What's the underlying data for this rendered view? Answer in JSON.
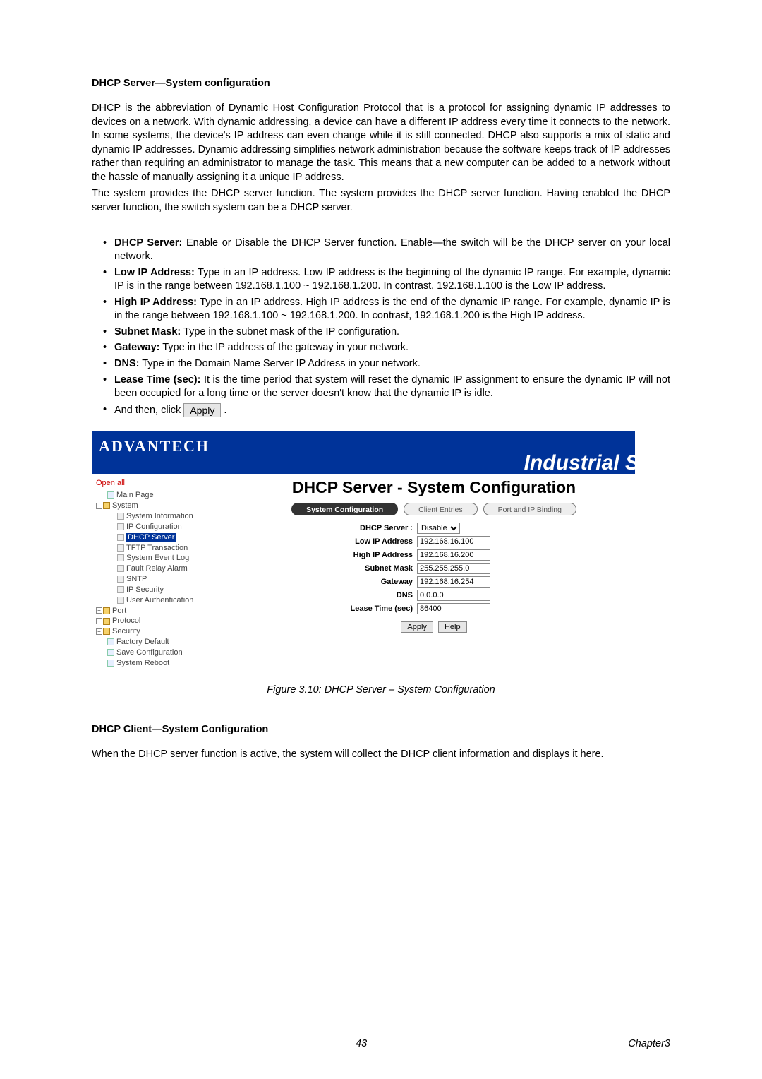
{
  "section1": {
    "title": "DHCP Server—System configuration",
    "para1": "DHCP is the abbreviation of Dynamic Host Configuration Protocol that is a protocol for assigning dynamic IP addresses to devices on a network. With dynamic addressing, a device can have a different IP address every time it connects to the network. In some systems, the device's IP address can even change while it is still connected. DHCP also supports a mix of static and dynamic IP addresses. Dynamic addressing simplifies network administration because the software keeps track of IP addresses rather than requiring an administrator to manage the task. This means that a new computer can be added to a network without the hassle of manually assigning it a unique IP address.",
    "para2": "The system provides the DHCP server function. The system provides the DHCP server function. Having enabled the DHCP server function, the switch system can be a DHCP server."
  },
  "bullets": [
    {
      "lead": "DHCP Server:",
      "rest": " Enable or Disable the DHCP Server function. Enable—the switch will be the DHCP server on your local network."
    },
    {
      "lead": "Low IP Address:",
      "rest": " Type in an IP address. Low IP address is the beginning of the dynamic IP range. For example, dynamic IP is in the range between 192.168.1.100 ~ 192.168.1.200. In contrast, 192.168.1.100 is the Low IP address."
    },
    {
      "lead": "High IP Address:",
      "rest": " Type in an IP address. High IP address is the end of the dynamic IP range. For example, dynamic IP is in the range between 192.168.1.100 ~ 192.168.1.200. In contrast, 192.168.1.200 is the High IP address."
    },
    {
      "lead": "Subnet Mask:",
      "rest": " Type in the subnet mask of the IP configuration."
    },
    {
      "lead": "Gateway:",
      "rest": " Type in the IP address of the gateway in your network."
    },
    {
      "lead": "DNS:",
      "rest": " Type in the Domain Name Server IP Address in your network."
    },
    {
      "lead": "Lease Time (sec):",
      "rest": " It is the time period that system will reset the dynamic IP assignment to ensure the dynamic IP will not been occupied for a long time or the server doesn't know that the dynamic IP is idle."
    }
  ],
  "andThen": {
    "pre": "And then, click ",
    "btn": "Apply",
    "post": " ."
  },
  "screenshot": {
    "brand": "ADVANTECH",
    "product": "Industrial S",
    "sidebar": {
      "open_all": "Open all",
      "main_page": "Main Page",
      "system": "System",
      "system_children": [
        "System Information",
        "IP Configuration",
        "DHCP Server",
        "TFTP Transaction",
        "System Event Log",
        "Fault Relay Alarm",
        "SNTP",
        "IP Security",
        "User Authentication"
      ],
      "port": "Port",
      "protocol": "Protocol",
      "security": "Security",
      "factory_default": "Factory Default",
      "save_config": "Save Configuration",
      "system_reboot": "System Reboot"
    },
    "panel": {
      "title": "DHCP Server - System Configuration",
      "tabs": [
        "System Configuration",
        "Client Entries",
        "Port and IP Binding"
      ],
      "active_tab": 0,
      "dhcp_label": "DHCP Server :",
      "dhcp_value": "Disable",
      "fields": [
        {
          "label": "Low IP Address",
          "value": "192.168.16.100"
        },
        {
          "label": "High IP Address",
          "value": "192.168.16.200"
        },
        {
          "label": "Subnet Mask",
          "value": "255.255.255.0"
        },
        {
          "label": "Gateway",
          "value": "192.168.16.254"
        },
        {
          "label": "DNS",
          "value": "0.0.0.0"
        },
        {
          "label": "Lease Time (sec)",
          "value": "86400"
        }
      ],
      "apply": "Apply",
      "help": "Help"
    }
  },
  "figure_caption": "Figure 3.10: DHCP Server – System Configuration",
  "section2": {
    "title": "DHCP Client—System Configuration",
    "para": "When the DHCP server function is active, the system will collect the DHCP client information and displays it here."
  },
  "footer": {
    "page": "43",
    "chapter": "Chapter3"
  }
}
